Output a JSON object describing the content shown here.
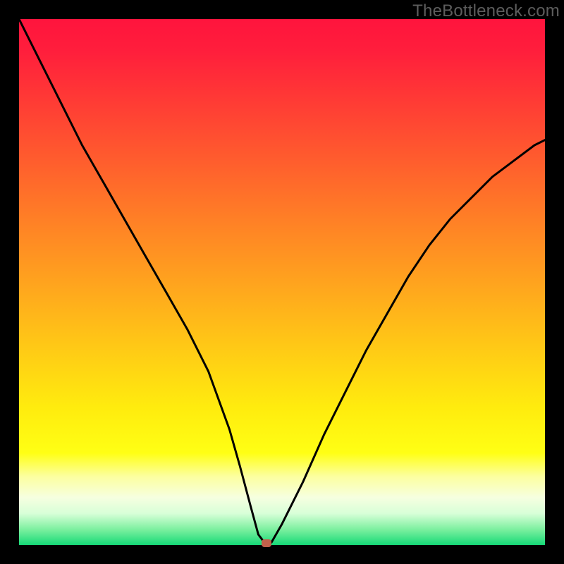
{
  "watermark": "TheBottleneck.com",
  "colors": {
    "frame": "#000000",
    "gradient_top": "#ff143d",
    "gradient_bottom": "#16d977",
    "curve": "#000000",
    "marker": "#c1614b",
    "watermark_text": "#5d5d5d"
  },
  "chart_data": {
    "type": "line",
    "title": "",
    "xlabel": "",
    "ylabel": "",
    "xlim": [
      0,
      100
    ],
    "ylim": [
      0,
      100
    ],
    "series": [
      {
        "name": "bottleneck-curve",
        "x": [
          0,
          4,
          8,
          12,
          16,
          20,
          24,
          28,
          32,
          36,
          40,
          42,
          44,
          45.5,
          47,
          48,
          50,
          54,
          58,
          62,
          66,
          70,
          74,
          78,
          82,
          86,
          90,
          94,
          98,
          100
        ],
        "values": [
          100,
          92,
          84,
          76,
          69,
          62,
          55,
          48,
          41,
          33,
          22,
          15,
          7.5,
          2,
          0,
          0.5,
          4,
          12,
          21,
          29,
          37,
          44,
          51,
          57,
          62,
          66,
          70,
          73,
          76,
          77
        ]
      }
    ],
    "annotations": [
      {
        "name": "optimum-marker",
        "x": 47,
        "y": 0
      }
    ]
  }
}
